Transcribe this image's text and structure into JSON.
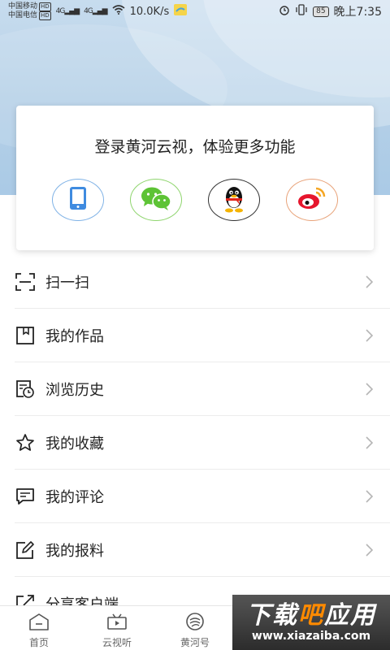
{
  "status_bar": {
    "carrier1": "中国移动",
    "carrier2": "中国电信",
    "hd": "HD",
    "net1": "4G",
    "net2": "4G",
    "speed": "10.0K/s",
    "battery": "85",
    "time": "晚上7:35"
  },
  "login": {
    "title": "登录黄河云视，体验更多功能",
    "methods": [
      {
        "icon": "phone-icon"
      },
      {
        "icon": "wechat-icon"
      },
      {
        "icon": "qq-icon"
      },
      {
        "icon": "weibo-icon"
      }
    ]
  },
  "menu": {
    "items": [
      {
        "label": "扫一扫",
        "icon": "scan-icon"
      },
      {
        "label": "我的作品",
        "icon": "bookmark-icon"
      },
      {
        "label": "浏览历史",
        "icon": "history-icon"
      },
      {
        "label": "我的收藏",
        "icon": "star-icon"
      },
      {
        "label": "我的评论",
        "icon": "comment-icon"
      },
      {
        "label": "我的报料",
        "icon": "edit-icon"
      },
      {
        "label": "分享客户端",
        "icon": "share-icon"
      }
    ]
  },
  "bottom_nav": {
    "items": [
      {
        "label": "首页",
        "icon": "home-icon"
      },
      {
        "label": "云视听",
        "icon": "tv-icon"
      },
      {
        "label": "黄河号",
        "icon": "huanghe-icon"
      }
    ]
  },
  "watermark": {
    "text_a": "下载",
    "text_b": "吧",
    "text_c": "应用",
    "url": "www.xiazaiba.com"
  },
  "colors": {
    "hero": "#b3cfe7",
    "wechat": "#5dc335",
    "phone": "#3f8be0",
    "weibo": "#e6162d"
  }
}
